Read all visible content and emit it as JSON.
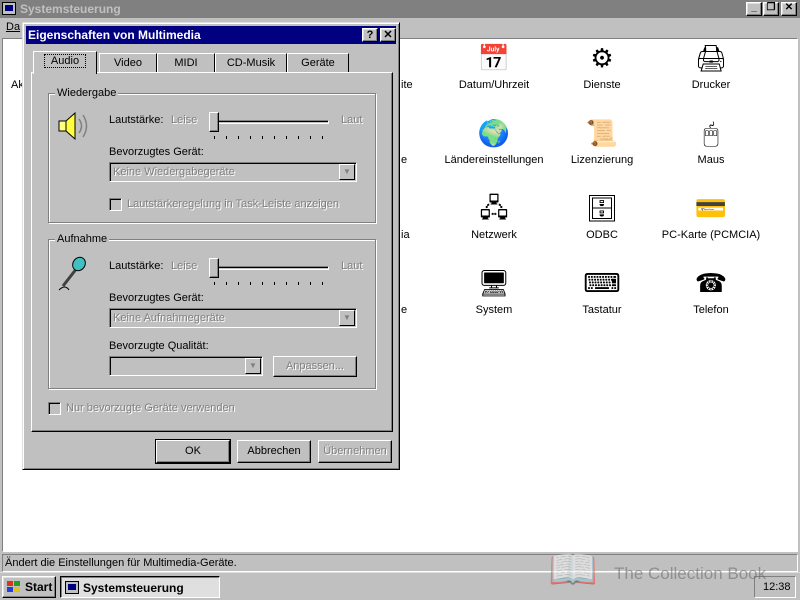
{
  "main_window": {
    "title": "Systemsteuerung",
    "menu_first": "Da",
    "status_text": "Ändert die Einstellungen für Multimedia-Geräte.",
    "partial_labels": [
      "Ak",
      "ite",
      "e",
      "ia",
      "e"
    ],
    "items": [
      {
        "label": "Datum/Uhrzeit",
        "icon": "calendar-clock-icon",
        "glyph": "📅"
      },
      {
        "label": "Dienste",
        "icon": "gears-icon",
        "glyph": "⚙"
      },
      {
        "label": "Drucker",
        "icon": "printer-folder-icon",
        "glyph": "🖨"
      },
      {
        "label": "Ländereinstellungen",
        "icon": "globe-icon",
        "glyph": "🌍"
      },
      {
        "label": "Lizenzierung",
        "icon": "certificate-icon",
        "glyph": "📜"
      },
      {
        "label": "Maus",
        "icon": "mouse-icon",
        "glyph": "🖱"
      },
      {
        "label": "Netzwerk",
        "icon": "network-icon",
        "glyph": "🖧"
      },
      {
        "label": "ODBC",
        "icon": "odbc-icon",
        "glyph": "🗄"
      },
      {
        "label": "PC-Karte (PCMCIA)",
        "icon": "pc-card-icon",
        "glyph": "💳"
      },
      {
        "label": "System",
        "icon": "computer-icon",
        "glyph": "🖥"
      },
      {
        "label": "Tastatur",
        "icon": "keyboard-icon",
        "glyph": "⌨"
      },
      {
        "label": "Telefon",
        "icon": "telephone-icon",
        "glyph": "☎"
      }
    ]
  },
  "dialog": {
    "title": "Eigenschaften von Multimedia",
    "help_glyph": "?",
    "close_glyph": "✕",
    "tabs": [
      "Audio",
      "Video",
      "MIDI",
      "CD-Musik",
      "Geräte"
    ],
    "active_tab": "Audio",
    "playback": {
      "group_title": "Wiedergabe",
      "volume_label": "Lautstärke:",
      "volume_min": "Leise",
      "volume_max": "Laut",
      "device_label": "Bevorzugtes Gerät:",
      "device_value": "Keine Wiedergabegeräte",
      "taskbar_checkbox": "Lautstärkeregelung in Task-Leiste anzeigen",
      "taskbar_checked": false
    },
    "recording": {
      "group_title": "Aufnahme",
      "volume_label": "Lautstärke:",
      "volume_min": "Leise",
      "volume_max": "Laut",
      "device_label": "Bevorzugtes Gerät:",
      "device_value": "Keine Aufnahmegeräte",
      "quality_label": "Bevorzugte Qualität:",
      "quality_value": "",
      "customize_button": "Anpassen..."
    },
    "only_preferred_checkbox": "Nur bevorzugte Geräte verwenden",
    "only_preferred_checked": false,
    "buttons": {
      "ok": "OK",
      "cancel": "Abbrechen",
      "apply": "Übernehmen"
    }
  },
  "taskbar": {
    "start_label": "Start",
    "task_label": "Systemsteuerung",
    "clock": "12:38"
  },
  "watermark": {
    "text": "The Collection Book"
  },
  "colors": {
    "face": "#c0c0c0",
    "title_active": "#000080",
    "title_inactive": "#808080",
    "client_bg": "#ffffff",
    "disabled_text": "#808080"
  }
}
